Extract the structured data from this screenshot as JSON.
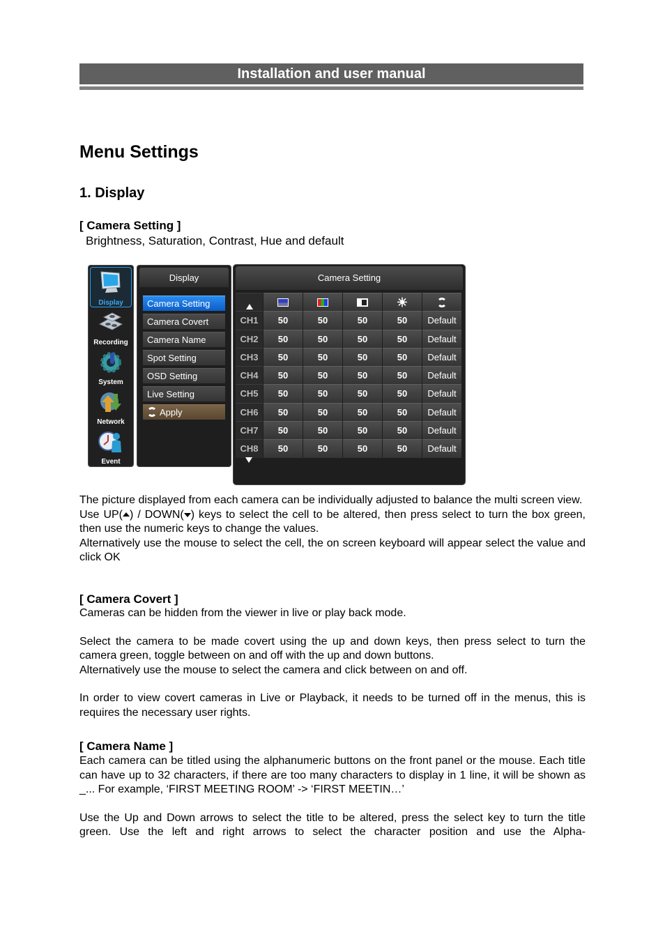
{
  "header": {
    "title": "Installation and user manual"
  },
  "page_title": "Menu Settings",
  "section_title": "1. Display",
  "camera_setting": {
    "heading": "[ Camera Setting ]",
    "subtitle": "Brightness, Saturation, Contrast, Hue and default",
    "p1": "The picture displayed from each camera can be individually adjusted to balance the multi screen view.",
    "p2_pre": "Use UP(",
    "p2_mid": ") / DOWN(",
    "p2_post": ") keys to select the cell to be altered, then press select to turn the box green, then use the numeric keys to change the values.",
    "p3": "Alternatively use the mouse to select the cell, the on screen keyboard will appear select the value and click OK"
  },
  "camera_covert": {
    "heading": "[ Camera Covert ]",
    "p1": "Cameras can be hidden from the viewer in live or play back mode.",
    "p2": "Select the camera to be made covert using the up and down keys, then press select to turn the camera green, toggle between on and off with the up and down buttons.",
    "p3": "Alternatively use the mouse to select the camera and click between on and off.",
    "p4": "In order to view covert cameras in Live or Playback, it needs to be turned off in the menus, this is requires the necessary user rights."
  },
  "camera_name": {
    "heading": "[ Camera Name ]",
    "p1": "Each camera can be titled using the alphanumeric buttons on the front panel or the mouse. Each title can have up to 32 characters, if there are too many characters to display in 1 line, it will be shown as _... For example, ‘FIRST MEETING ROOM’ -> ‘FIRST MEETIN…’",
    "p2": "Use the Up and Down arrows to select the title to be altered, press the select key to turn the title green. Use the left and right arrows to select the character position and use the Alpha-"
  },
  "ui": {
    "sidebar": [
      {
        "label": "Display",
        "icon": "monitor-icon",
        "active": true
      },
      {
        "label": "Recording",
        "icon": "recording-icon",
        "active": false
      },
      {
        "label": "System",
        "icon": "gear-icon",
        "active": false
      },
      {
        "label": "Network",
        "icon": "network-icon",
        "active": false
      },
      {
        "label": "Event",
        "icon": "clock-person-icon",
        "active": false
      }
    ],
    "menu": {
      "title": "Display",
      "items": [
        "Camera Setting",
        "Camera Covert",
        "Camera Name",
        "Spot Setting",
        "OSD Setting",
        "Live Setting"
      ],
      "active_index": 0,
      "apply_label": "Apply"
    },
    "camera_setting": {
      "title": "Camera Setting",
      "columns": [
        "brightness-icon",
        "saturation-icon",
        "contrast-icon",
        "hue-icon",
        "default-icon"
      ],
      "rows": [
        {
          "ch": "CH1",
          "values": [
            "50",
            "50",
            "50",
            "50"
          ],
          "default": "Default"
        },
        {
          "ch": "CH2",
          "values": [
            "50",
            "50",
            "50",
            "50"
          ],
          "default": "Default"
        },
        {
          "ch": "CH3",
          "values": [
            "50",
            "50",
            "50",
            "50"
          ],
          "default": "Default"
        },
        {
          "ch": "CH4",
          "values": [
            "50",
            "50",
            "50",
            "50"
          ],
          "default": "Default"
        },
        {
          "ch": "CH5",
          "values": [
            "50",
            "50",
            "50",
            "50"
          ],
          "default": "Default"
        },
        {
          "ch": "CH6",
          "values": [
            "50",
            "50",
            "50",
            "50"
          ],
          "default": "Default"
        },
        {
          "ch": "CH7",
          "values": [
            "50",
            "50",
            "50",
            "50"
          ],
          "default": "Default"
        },
        {
          "ch": "CH8",
          "values": [
            "50",
            "50",
            "50",
            "50"
          ],
          "default": "Default"
        }
      ]
    }
  }
}
